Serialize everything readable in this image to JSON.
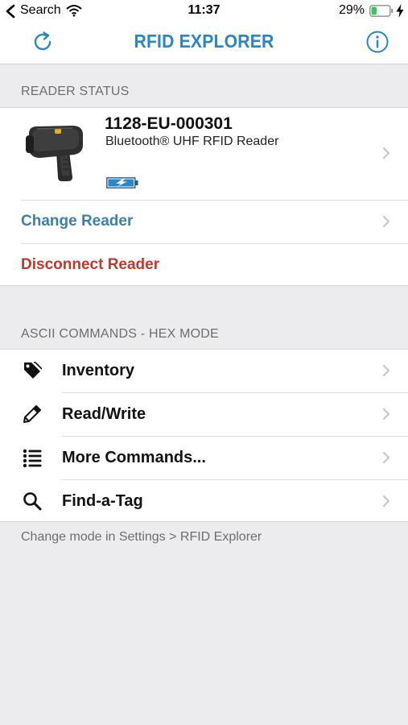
{
  "status_bar": {
    "carrier": "Search",
    "time": "11:37",
    "battery_percent": "29%",
    "battery_level": 0.29,
    "icons": [
      "back-arrow-icon",
      "wifi-icon",
      "battery-icon",
      "charging-bolt-icon"
    ]
  },
  "nav": {
    "title": "RFID EXPLORER",
    "left_icon": "refresh-icon",
    "right_icon": "info-icon",
    "accent_color": "#2a86c6"
  },
  "reader_status": {
    "header": "READER STATUS",
    "reader_id": "1128-EU-000301",
    "reader_desc": "Bluetooth® UHF RFID Reader",
    "reader_icon": "rfid-reader-image",
    "battery_icon": "reader-battery-charging-icon",
    "change_reader_label": "Change Reader",
    "disconnect_reader_label": "Disconnect Reader",
    "change_color": "#3a7fae",
    "disconnect_color": "#c0392b"
  },
  "commands": {
    "header": "ASCII COMMANDS - HEX MODE",
    "items": [
      {
        "label": "Inventory",
        "icon": "tag-icon"
      },
      {
        "label": "Read/Write",
        "icon": "pencil-icon"
      },
      {
        "label": "More Commands...",
        "icon": "list-icon"
      },
      {
        "label": "Find-a-Tag",
        "icon": "search-icon"
      }
    ],
    "footer": "Change mode in Settings > RFID Explorer"
  }
}
